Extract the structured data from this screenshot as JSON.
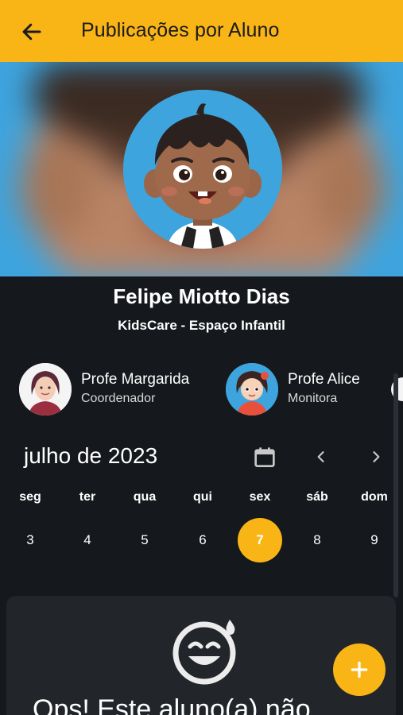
{
  "header": {
    "title": "Publicações por Aluno",
    "back_icon": "arrow-left-icon",
    "accent_color": "#f9b516"
  },
  "student": {
    "name": "Felipe Miotto Dias",
    "school": "KidsCare - Espaço Infantil"
  },
  "staff": [
    {
      "name": "Profe Margarida",
      "role": "Coordenador"
    },
    {
      "name": "Profe Alice",
      "role": "Monitora"
    }
  ],
  "calendar": {
    "month_label": "julho de 2023",
    "weekdays": [
      "seg",
      "ter",
      "qua",
      "qui",
      "sex",
      "sáb",
      "dom"
    ],
    "days": [
      "3",
      "4",
      "5",
      "6",
      "7",
      "8",
      "9"
    ],
    "selected_day": "7",
    "icons": [
      "calendar-icon",
      "chevron-left-icon",
      "chevron-right-icon"
    ]
  },
  "empty_state": {
    "message": "Ops! Este aluno(a) não",
    "icon": "smile-sweat-icon"
  },
  "fab": {
    "icon": "plus-icon"
  }
}
